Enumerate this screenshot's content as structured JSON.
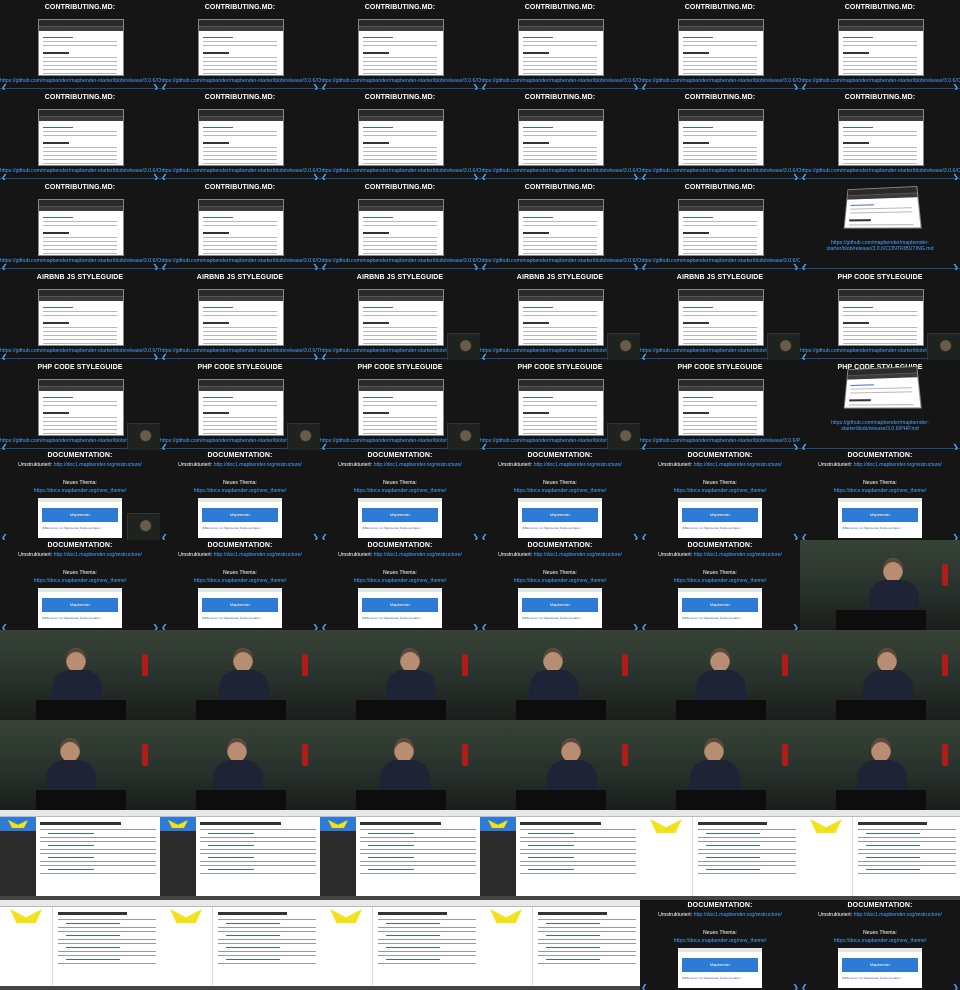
{
  "texts": {
    "contributing": "CONTRIBUTING.MD:",
    "airbnb": "AIRBNB JS STYLEGUIDE",
    "php": "PHP CODE STYLEGUIDE",
    "documentation": "DOCUMENTATION:",
    "link_contributing": "https://github.com/mapbender/mapbender-starter/blob/release/3.0.6/CONTRIBUTING.md",
    "link_airbnb": "https://github.com/mapbender/mapbender-starter/blob/release/3.0.6/TYLE.md",
    "link_php": "https://github.com/mapbender/mapbender-starter/blob/release/3.0.6/PHP.md",
    "doc_restruct_label": "Umstrukturiert:",
    "doc_restruct_link": "http://doc1.mapbender.org/restructure/",
    "doc_theme_label": "Neues Thema:",
    "doc_theme_link": "https://docs.mapbender.org/new_theme/",
    "doc_site_title": "Mapbender",
    "doc_site_foot": "Willkommen zur Mapbender Dokumentation",
    "nav_prev": "❮",
    "nav_next": "❯"
  },
  "colors": {
    "background": "#000000",
    "slide_bg": "#151515",
    "link": "#4aa3ff",
    "doc_header": "#2e7bd6",
    "logo": "#f2e21b",
    "extinguisher": "#b31a1a"
  },
  "tiles": [
    {
      "kind": "slide",
      "title": "contributing",
      "link": "link_contributing"
    },
    {
      "kind": "slide",
      "title": "contributing",
      "link": "link_contributing"
    },
    {
      "kind": "slide",
      "title": "contributing",
      "link": "link_contributing"
    },
    {
      "kind": "slide",
      "title": "contributing",
      "link": "link_contributing"
    },
    {
      "kind": "slide",
      "title": "contributing",
      "link": "link_contributing"
    },
    {
      "kind": "slide",
      "title": "contributing",
      "link": "link_contributing"
    },
    {
      "kind": "slide",
      "title": "contributing",
      "link": "link_contributing"
    },
    {
      "kind": "slide",
      "title": "contributing",
      "link": "link_contributing"
    },
    {
      "kind": "slide",
      "title": "contributing",
      "link": "link_contributing"
    },
    {
      "kind": "slide",
      "title": "contributing",
      "link": "link_contributing"
    },
    {
      "kind": "slide",
      "title": "contributing",
      "link": "link_contributing"
    },
    {
      "kind": "slide",
      "title": "contributing",
      "link": "link_contributing"
    },
    {
      "kind": "slide",
      "title": "contributing",
      "link": "link_contributing"
    },
    {
      "kind": "slide",
      "title": "contributing",
      "link": "link_contributing"
    },
    {
      "kind": "slide",
      "title": "contributing",
      "link": "link_contributing"
    },
    {
      "kind": "slide",
      "title": "contributing",
      "link": "link_contributing"
    },
    {
      "kind": "slide",
      "title": "contributing",
      "link": "link_contributing"
    },
    {
      "kind": "slide",
      "title": "",
      "link": "link_contributing",
      "tilted": true
    },
    {
      "kind": "slide",
      "title": "airbnb",
      "link": "link_airbnb"
    },
    {
      "kind": "slide",
      "title": "airbnb",
      "link": "link_airbnb"
    },
    {
      "kind": "slide",
      "title": "airbnb",
      "link": "link_airbnb",
      "pip": true
    },
    {
      "kind": "slide",
      "title": "airbnb",
      "link": "link_airbnb",
      "pip": true
    },
    {
      "kind": "slide",
      "title": "airbnb",
      "link": "link_airbnb",
      "pip": true
    },
    {
      "kind": "slide",
      "title": "php",
      "link": "link_php",
      "pip": true
    },
    {
      "kind": "slide",
      "title": "php",
      "link": "link_php",
      "pip": true
    },
    {
      "kind": "slide",
      "title": "php",
      "link": "link_php",
      "pip": true
    },
    {
      "kind": "slide",
      "title": "php",
      "link": "link_php",
      "pip": true
    },
    {
      "kind": "slide",
      "title": "php",
      "link": "link_php",
      "pip": true
    },
    {
      "kind": "slide",
      "title": "php",
      "link": "link_php"
    },
    {
      "kind": "slide",
      "title": "php",
      "link": "link_php",
      "tilted": true
    },
    {
      "kind": "doc",
      "pip": true
    },
    {
      "kind": "doc"
    },
    {
      "kind": "doc"
    },
    {
      "kind": "doc"
    },
    {
      "kind": "doc"
    },
    {
      "kind": "doc"
    },
    {
      "kind": "doc"
    },
    {
      "kind": "doc"
    },
    {
      "kind": "doc"
    },
    {
      "kind": "doc"
    },
    {
      "kind": "doc"
    },
    {
      "kind": "speaker"
    },
    {
      "kind": "speaker"
    },
    {
      "kind": "speaker"
    },
    {
      "kind": "speaker"
    },
    {
      "kind": "speaker"
    },
    {
      "kind": "speaker"
    },
    {
      "kind": "speaker"
    },
    {
      "kind": "speaker"
    },
    {
      "kind": "speaker"
    },
    {
      "kind": "speaker"
    },
    {
      "kind": "speaker"
    },
    {
      "kind": "speaker"
    },
    {
      "kind": "speaker"
    },
    {
      "kind": "site"
    },
    {
      "kind": "site"
    },
    {
      "kind": "site"
    },
    {
      "kind": "site"
    },
    {
      "kind": "site",
      "big": true
    },
    {
      "kind": "site",
      "big": true
    },
    {
      "kind": "site",
      "big": true
    },
    {
      "kind": "site",
      "big": true
    },
    {
      "kind": "site",
      "big": true
    },
    {
      "kind": "site",
      "big": true
    },
    {
      "kind": "doc"
    },
    {
      "kind": "doc"
    }
  ]
}
